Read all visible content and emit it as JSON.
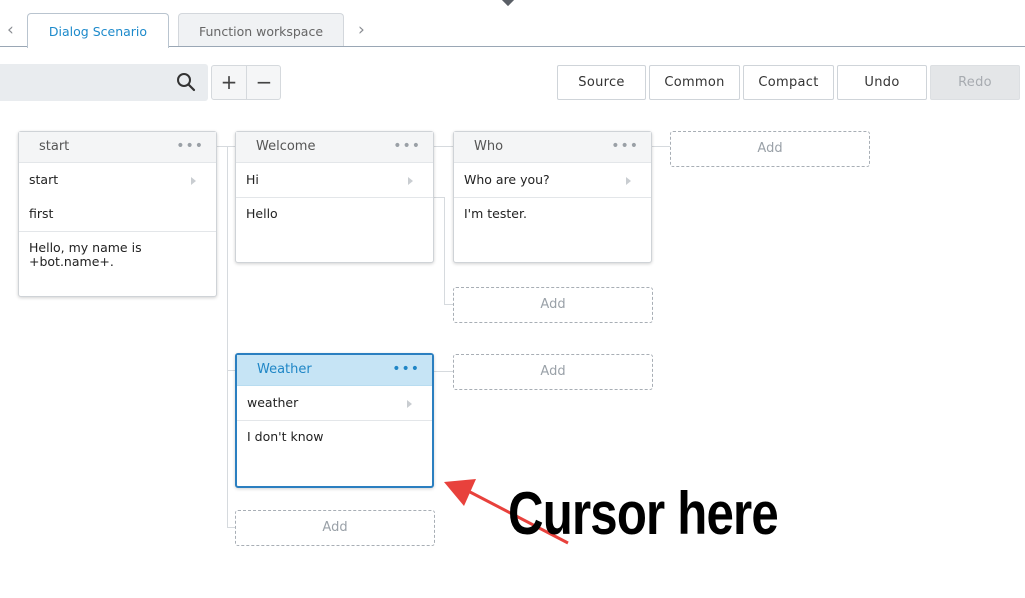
{
  "tabs": [
    {
      "label": "Dialog Scenario",
      "active": true
    },
    {
      "label": "Function workspace",
      "active": false
    }
  ],
  "toolbar": {
    "search_icon": "search-icon",
    "zoom_in": "+",
    "zoom_out": "−",
    "buttons": {
      "source": "Source",
      "common": "Common",
      "compact": "Compact",
      "undo": "Undo",
      "redo": "Redo"
    }
  },
  "nodes": {
    "start": {
      "title": "start",
      "triggers": [
        "start",
        "first"
      ],
      "response": "Hello, my name is +bot.name+."
    },
    "welcome": {
      "title": "Welcome",
      "triggers": [
        "Hi"
      ],
      "response": "Hello"
    },
    "who": {
      "title": "Who",
      "triggers": [
        "Who are you?"
      ],
      "response": "I'm tester."
    },
    "weather": {
      "title": "Weather",
      "triggers": [
        "weather"
      ],
      "response": "I don't know"
    }
  },
  "add_label": "Add",
  "annotation": {
    "text": "Cursor here"
  },
  "colors": {
    "accent": "#1d8acb",
    "selected_header": "#c6e4f5",
    "annotation_arrow": "#e8413c"
  }
}
